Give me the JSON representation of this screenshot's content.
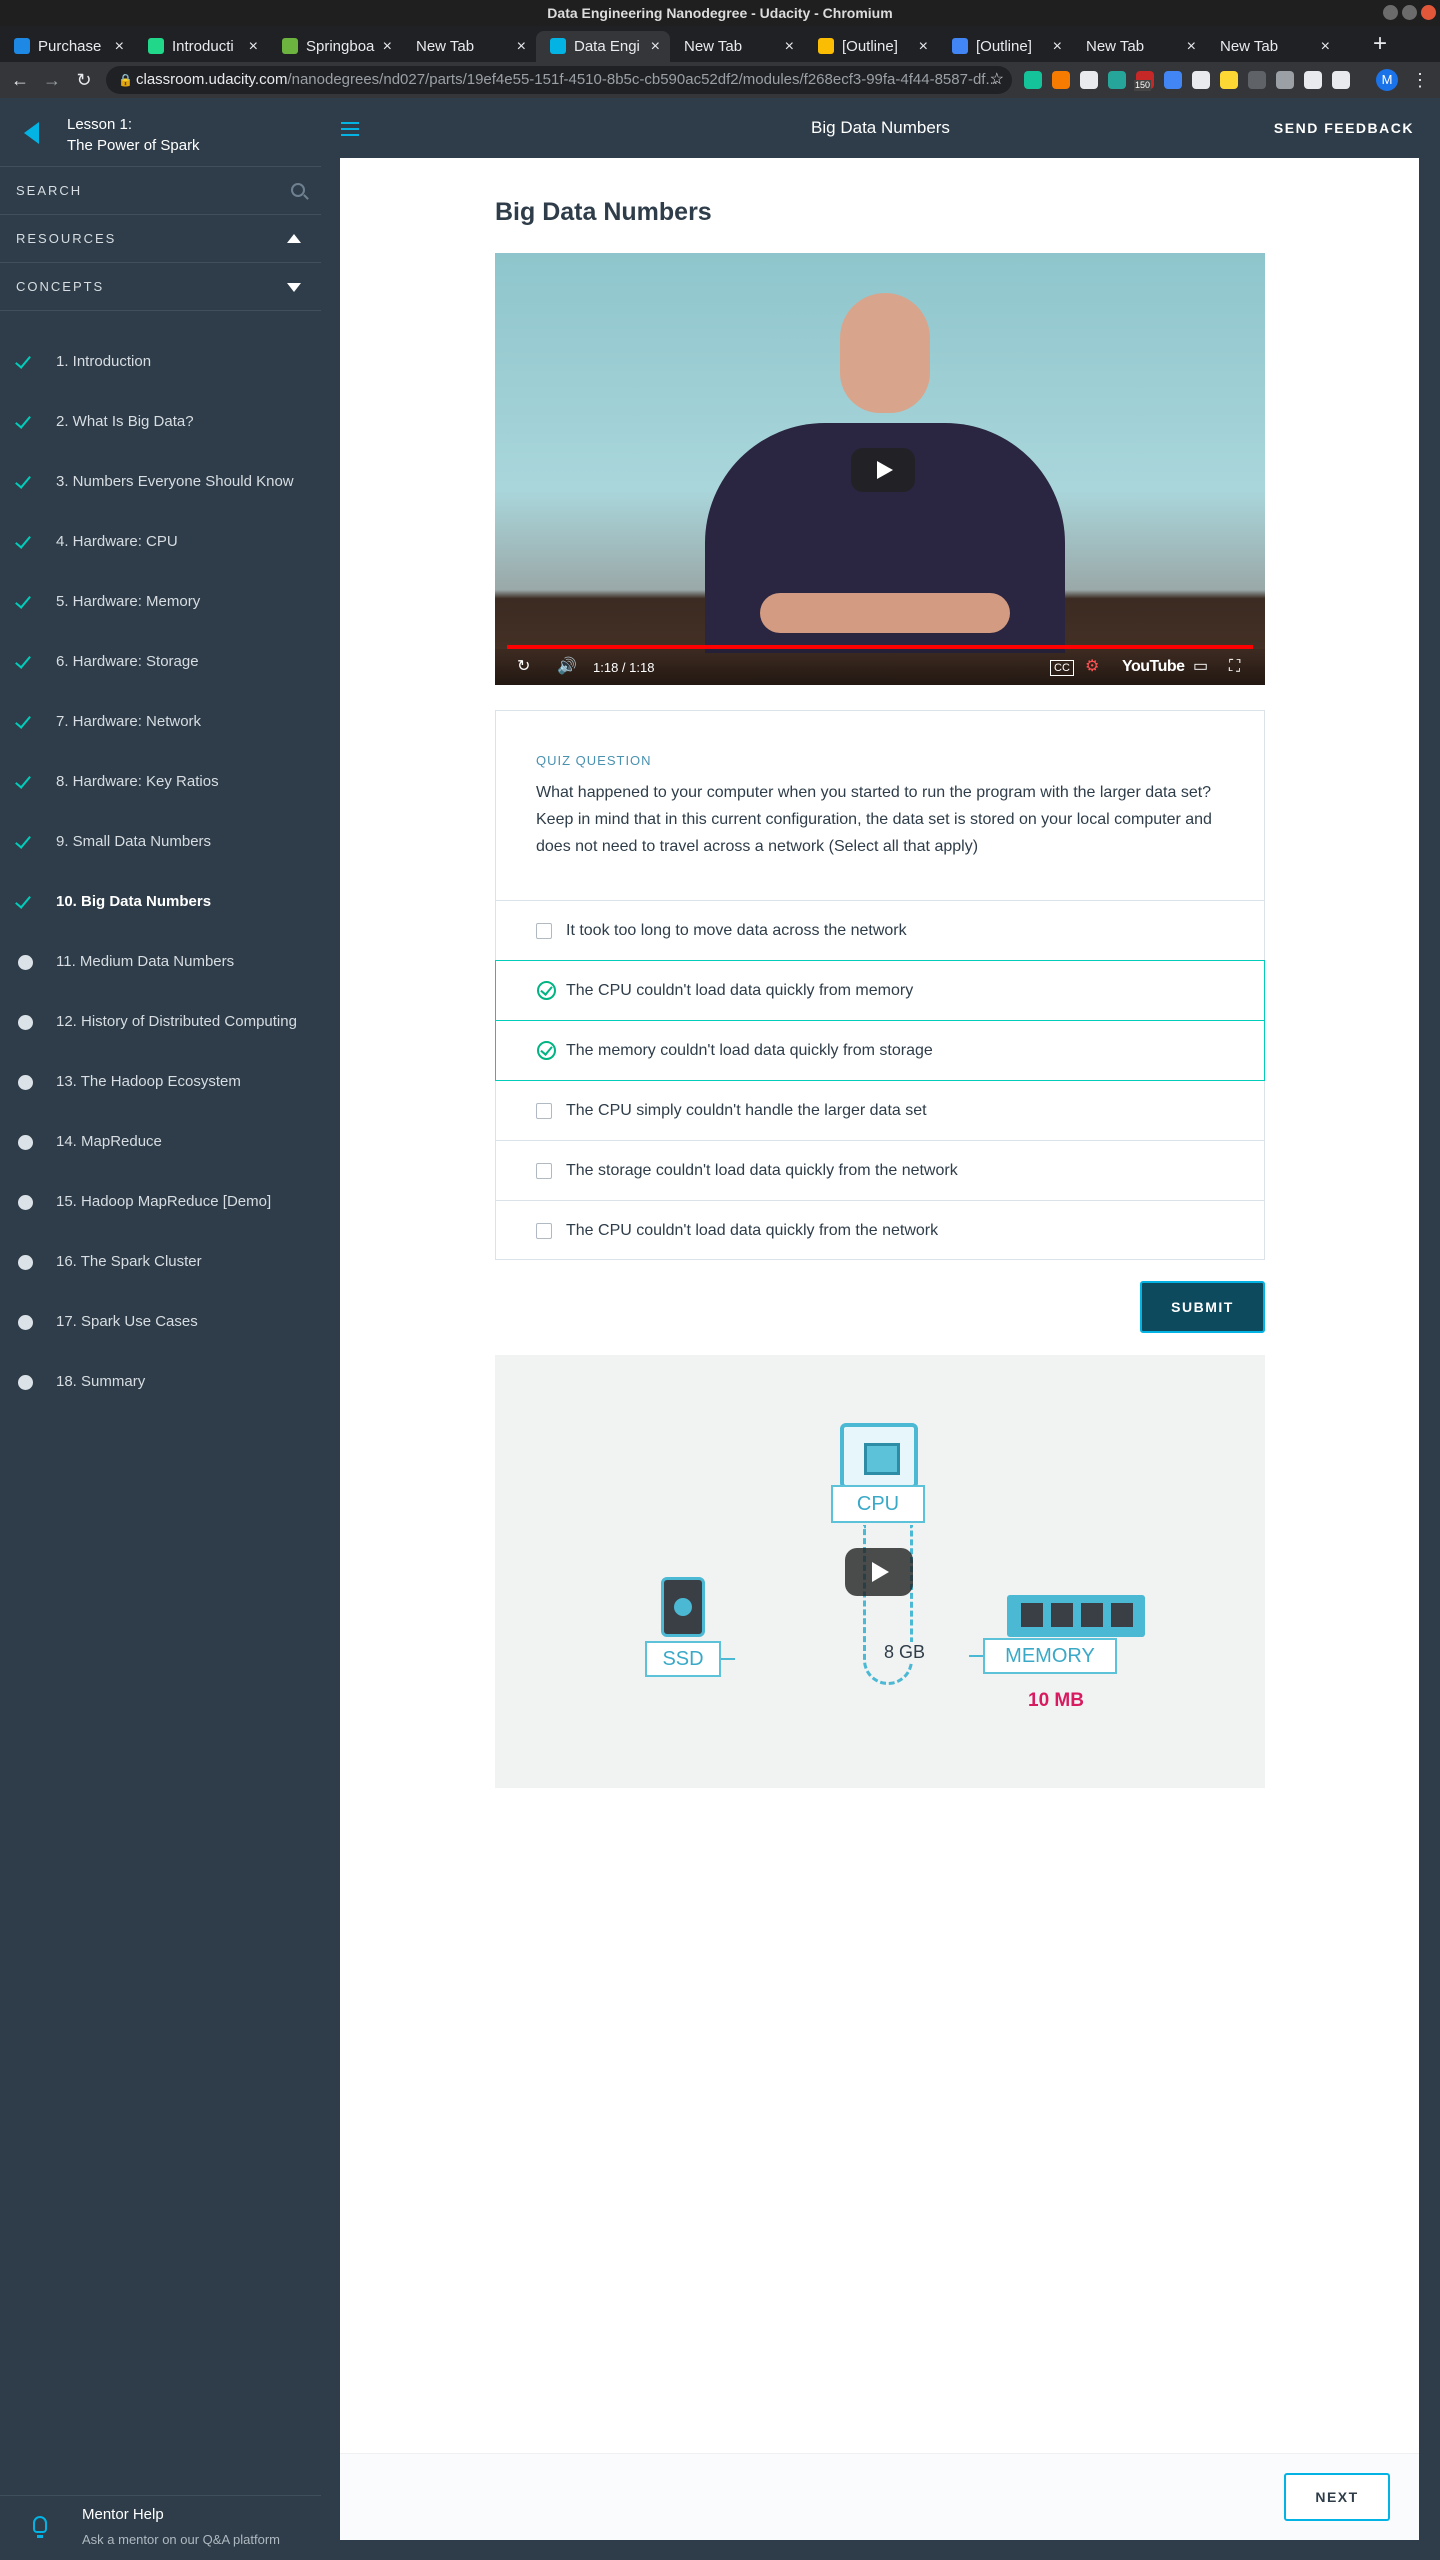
{
  "window": {
    "title": "Data Engineering Nanodegree - Udacity - Chromium"
  },
  "browser": {
    "tabs": [
      {
        "title": "Purchase",
        "favicon_color": "#1e88e5"
      },
      {
        "title": "Introducti",
        "favicon_color": "#21d789"
      },
      {
        "title": "Springboa",
        "favicon_color": "#6db33f"
      },
      {
        "title": "New Tab",
        "favicon_color": ""
      },
      {
        "title": "Data Engi",
        "favicon_color": "#02b3e4"
      },
      {
        "title": "New Tab",
        "favicon_color": ""
      },
      {
        "title": "[Outline]",
        "favicon_color": "#fbbc04"
      },
      {
        "title": "[Outline]",
        "favicon_color": "#4285f4"
      },
      {
        "title": "New Tab",
        "favicon_color": ""
      },
      {
        "title": "New Tab",
        "favicon_color": ""
      }
    ],
    "url_host": "classroom.udacity.com",
    "url_path": "/nanodegrees/nd027/parts/19ef4e55-151f-4510-8b5c-cb590ac52df2/modules/f268ecf3-99fa-4f44-8587-df...",
    "extensions": [
      {
        "name": "grammarly-icon",
        "color": "#15c39a"
      },
      {
        "name": "ext-orange-icon",
        "color": "#f57c00"
      },
      {
        "name": "doc-icon",
        "color": "#e8eaed"
      },
      {
        "name": "ext-teal-icon",
        "color": "#26a69a"
      },
      {
        "name": "ext-badge-icon",
        "color": "#c62828",
        "badge": "150"
      },
      {
        "name": "ext-blue-icon",
        "color": "#4285f4"
      },
      {
        "name": "cloud-icon",
        "color": "#e8eaed"
      },
      {
        "name": "ext-yellow-icon",
        "color": "#fdd835"
      },
      {
        "name": "ext-gray-icon",
        "color": "#5f6368"
      },
      {
        "name": "history-icon",
        "color": "#9aa0a6"
      },
      {
        "name": "puzzle-icon",
        "color": "#e8eaed"
      },
      {
        "name": "media-icon",
        "color": "#e8eaed"
      }
    ],
    "profile_initial": "M"
  },
  "sidebar": {
    "lesson_label": "Lesson 1:",
    "lesson_title": "The Power of Spark",
    "search_label": "SEARCH",
    "resources_label": "RESOURCES",
    "concepts_label": "CONCEPTS",
    "concepts": [
      {
        "label": "1. Introduction",
        "status": "done"
      },
      {
        "label": "2. What Is Big Data?",
        "status": "done"
      },
      {
        "label": "3. Numbers Everyone Should Know",
        "status": "done"
      },
      {
        "label": "4. Hardware: CPU",
        "status": "done"
      },
      {
        "label": "5. Hardware: Memory",
        "status": "done"
      },
      {
        "label": "6. Hardware: Storage",
        "status": "done"
      },
      {
        "label": "7. Hardware: Network",
        "status": "done"
      },
      {
        "label": "8. Hardware: Key Ratios",
        "status": "done"
      },
      {
        "label": "9. Small Data Numbers",
        "status": "done"
      },
      {
        "label": "10. Big Data Numbers",
        "status": "current"
      },
      {
        "label": "11. Medium Data Numbers",
        "status": "todo"
      },
      {
        "label": "12. History of Distributed Computing",
        "status": "todo"
      },
      {
        "label": "13. The Hadoop Ecosystem",
        "status": "todo"
      },
      {
        "label": "14. MapReduce",
        "status": "todo"
      },
      {
        "label": "15. Hadoop MapReduce [Demo]",
        "status": "todo"
      },
      {
        "label": "16. The Spark Cluster",
        "status": "todo"
      },
      {
        "label": "17. Spark Use Cases",
        "status": "todo"
      },
      {
        "label": "18. Summary",
        "status": "todo"
      }
    ],
    "mentor_title": "Mentor Help",
    "mentor_subtitle": "Ask a mentor on our Q&A platform"
  },
  "topbar": {
    "title": "Big Data Numbers",
    "feedback_label": "SEND FEEDBACK"
  },
  "main": {
    "heading": "Big Data Numbers",
    "video1": {
      "time": "1:18 / 1:18",
      "youtube_label": "YouTube",
      "progress": 1.0
    },
    "quiz": {
      "label": "QUIZ QUESTION",
      "question": "What happened to your computer when you started to run the program with the larger data set? Keep in mind that in this current configuration, the data set is stored on your local computer and does not need to travel across a network (Select all that apply)",
      "options": [
        {
          "text": "It took too long to move data across the network",
          "selected": false
        },
        {
          "text": "The CPU couldn't load data quickly from memory",
          "selected": true
        },
        {
          "text": "The memory couldn't load data quickly from storage",
          "selected": true
        },
        {
          "text": "The CPU simply couldn't handle the larger data set",
          "selected": false
        },
        {
          "text": "The storage couldn't load data quickly from the network",
          "selected": false
        },
        {
          "text": "The CPU couldn't load data quickly from the network",
          "selected": false
        }
      ],
      "submit_label": "SUBMIT"
    },
    "video2": {
      "cpu_label": "CPU",
      "ssd_label": "SSD",
      "memory_label": "MEMORY",
      "memory_size": "10 MB",
      "link_size": "8 GB"
    },
    "next_label": "NEXT"
  },
  "colors": {
    "accent": "#02b3e4",
    "check": "#02ccba",
    "sidebar_bg": "#2e3d49",
    "submit_bg": "#0d4a5e",
    "memory_size": "#d81b60"
  }
}
